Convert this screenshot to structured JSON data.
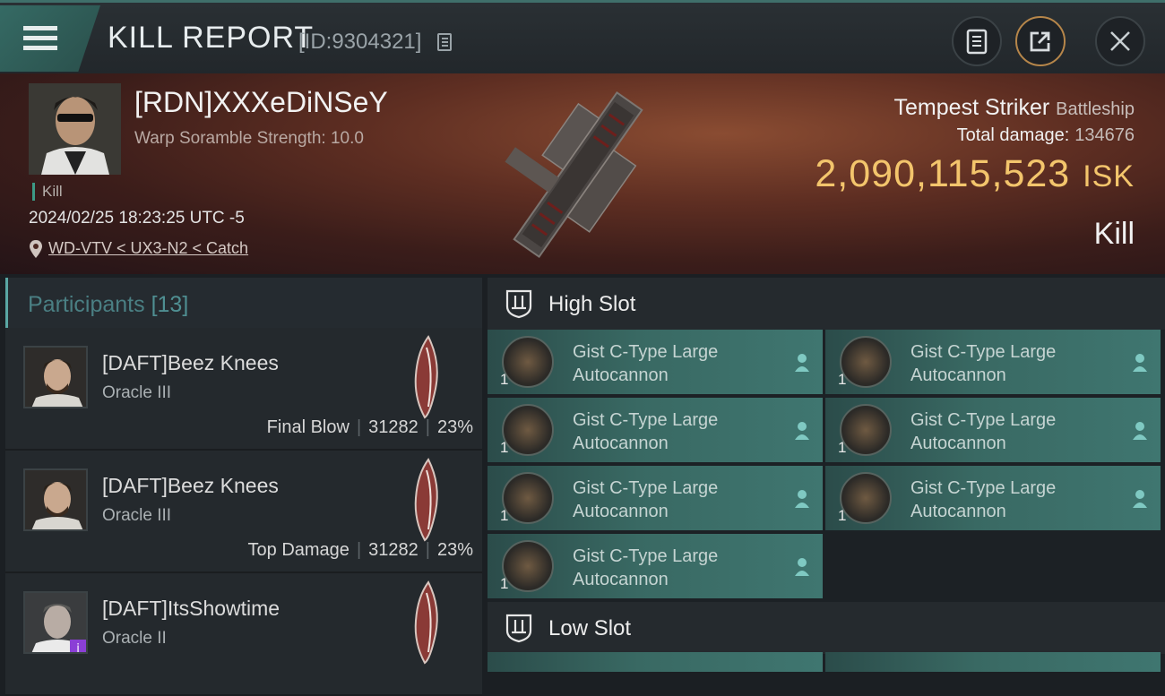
{
  "header": {
    "title": "KILL REPORT",
    "report_id": "[ID:9304321]"
  },
  "victim": {
    "pilot_name": "[RDN]XXXeDiNSeY",
    "scramble": "Warp Soramble Strength: 10.0",
    "kill_tag": "Kill",
    "datetime": "2024/02/25 18:23:25 UTC -5",
    "location": "WD-VTV < UX3-N2 < Catch",
    "ship_name": "Tempest Striker",
    "ship_class": "Battleship",
    "total_damage_label": "Total damage:",
    "total_damage": "134676",
    "isk_value": "2,090,115,523",
    "isk_unit": "ISK",
    "result": "Kill"
  },
  "participants": {
    "label": "Participants",
    "count": "[13]",
    "items": [
      {
        "name": "[DAFT]Beez Knees",
        "ship": "Oracle III",
        "role": "Final Blow",
        "damage": "31282",
        "percent": "23%"
      },
      {
        "name": "[DAFT]Beez Knees",
        "ship": "Oracle III",
        "role": "Top Damage",
        "damage": "31282",
        "percent": "23%"
      },
      {
        "name": "[DAFT]ItsShowtime",
        "ship": "Oracle II",
        "role": "",
        "damage": "",
        "percent": ""
      }
    ]
  },
  "slots": {
    "high_label": "High Slot",
    "low_label": "Low Slot",
    "high_modules": [
      {
        "qty": "1",
        "line1": "Gist C-Type Large",
        "line2": "Autocannon"
      },
      {
        "qty": "1",
        "line1": "Gist C-Type Large",
        "line2": "Autocannon"
      },
      {
        "qty": "1",
        "line1": "Gist C-Type Large",
        "line2": "Autocannon"
      },
      {
        "qty": "1",
        "line1": "Gist C-Type Large",
        "line2": "Autocannon"
      },
      {
        "qty": "1",
        "line1": "Gist C-Type Large",
        "line2": "Autocannon"
      },
      {
        "qty": "1",
        "line1": "Gist C-Type Large",
        "line2": "Autocannon"
      },
      {
        "qty": "1",
        "line1": "Gist C-Type Large",
        "line2": "Autocannon"
      }
    ]
  },
  "colors": {
    "accent_teal": "#3f7670",
    "isk_gold": "#f3c56c"
  }
}
